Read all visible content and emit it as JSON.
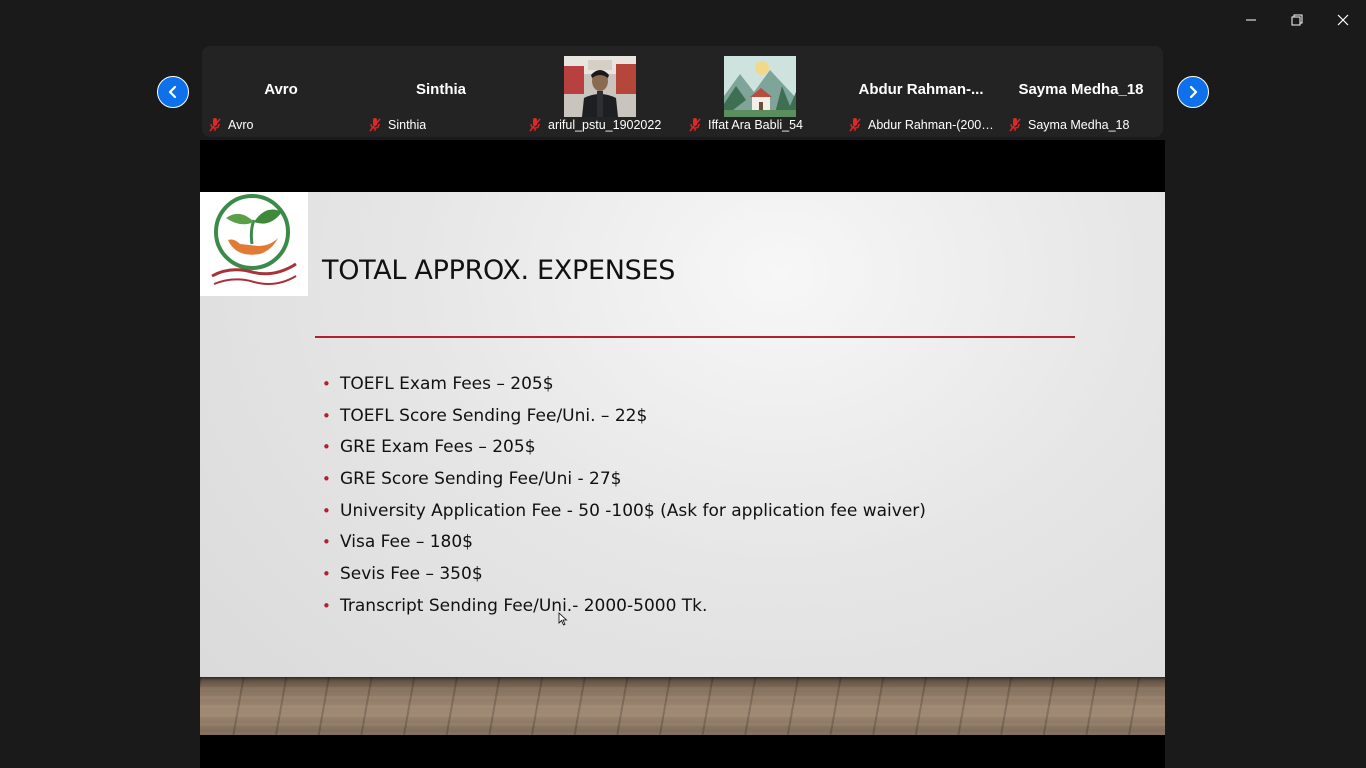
{
  "window": {
    "controls": [
      "minimize-icon",
      "restore-icon",
      "close-icon"
    ]
  },
  "gallery": {
    "prev_icon": "chevron-left-icon",
    "next_icon": "chevron-right-icon",
    "accent": "#0e71eb",
    "participants": [
      {
        "display": "Avro",
        "label": "Avro",
        "video": false,
        "muted": true
      },
      {
        "display": "Sinthia",
        "label": "Sinthia",
        "video": false,
        "muted": true
      },
      {
        "display": "",
        "label": "ariful_pstu_1902022",
        "video": true,
        "muted": true
      },
      {
        "display": "",
        "label": "Iffat Ara Babli_54",
        "video": true,
        "muted": true
      },
      {
        "display": "Abdur  Rahman-...",
        "label": "Abdur Rahman-(2002...",
        "video": false,
        "muted": true
      },
      {
        "display": "Sayma Medha_18",
        "label": "Sayma Medha_18",
        "video": false,
        "muted": true
      }
    ]
  },
  "slide": {
    "title": "TOTAL APPROX. EXPENSES",
    "accent": "#b41f2e",
    "bullets": [
      "TOEFL Exam Fees – 205$",
      "TOEFL Score Sending Fee/Uni. – 22$",
      "GRE Exam Fees – 205$",
      "GRE Score Sending Fee/Uni - 27$",
      "University Application Fee - 50 -100$ (Ask for application fee waiver)",
      "Visa Fee – 180$",
      "Sevis Fee – 350$",
      "Transcript Sending Fee/Uni.- 2000-5000 Tk."
    ]
  }
}
